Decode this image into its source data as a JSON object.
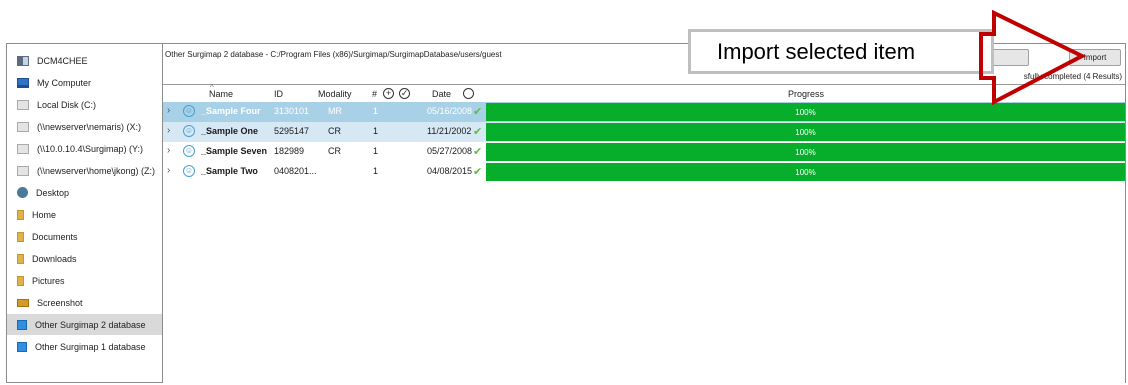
{
  "sidebar": {
    "items": [
      {
        "label": "DCM4CHEE",
        "icon": "server-icon"
      },
      {
        "label": "My Computer",
        "icon": "computer-icon"
      },
      {
        "label": "Local Disk (C:)",
        "icon": "disk-icon"
      },
      {
        "label": "(\\\\newserver\\nemaris) (X:)",
        "icon": "disk-icon"
      },
      {
        "label": "(\\\\10.0.10.4\\Surgimap) (Y:)",
        "icon": "disk-icon"
      },
      {
        "label": "(\\\\newserver\\home\\jkong) (Z:)",
        "icon": "disk-icon"
      },
      {
        "label": "Desktop",
        "icon": "desktop-icon"
      },
      {
        "label": "Home",
        "icon": "folder-icon"
      },
      {
        "label": "Documents",
        "icon": "folder-icon"
      },
      {
        "label": "Downloads",
        "icon": "folder-icon"
      },
      {
        "label": "Pictures",
        "icon": "folder-icon"
      },
      {
        "label": "Screenshot",
        "icon": "picture-folder-icon"
      },
      {
        "label": "Other Surgimap 2 database",
        "icon": "database-icon",
        "selected": true
      },
      {
        "label": "Other Surgimap 1 database",
        "icon": "database-icon"
      }
    ]
  },
  "header": {
    "path": "Other Surgimap 2 database - C:/Program Files (x86)/Surgimap/SurgimapDatabase/users/guest",
    "import_label": "Import",
    "status": "sfully completed (4 Results)"
  },
  "table": {
    "columns": {
      "name": "Name",
      "id": "ID",
      "modality": "Modality",
      "count": "#",
      "date": "Date",
      "progress": "Progress"
    },
    "rows": [
      {
        "name": "_Sample Four",
        "id": "3130101",
        "modality": "MR",
        "count": "1",
        "date": "05/16/2008",
        "progress": "100%"
      },
      {
        "name": "_Sample One",
        "id": "5295147",
        "modality": "CR",
        "count": "1",
        "date": "11/21/2002",
        "progress": "100%"
      },
      {
        "name": "_Sample Seven",
        "id": "182989",
        "modality": "CR",
        "count": "1",
        "date": "05/27/2008",
        "progress": "100%"
      },
      {
        "name": "_Sample Two",
        "id": "0408201...",
        "modality": "",
        "count": "1",
        "date": "04/08/2015",
        "progress": "100%"
      }
    ],
    "progress_fraction": [
      1,
      1,
      1,
      1
    ]
  },
  "callout": {
    "text": "Import selected item"
  },
  "colors": {
    "progress": "#07ae2c",
    "arrow": "#c00000",
    "selection": "#a8d0e6"
  }
}
